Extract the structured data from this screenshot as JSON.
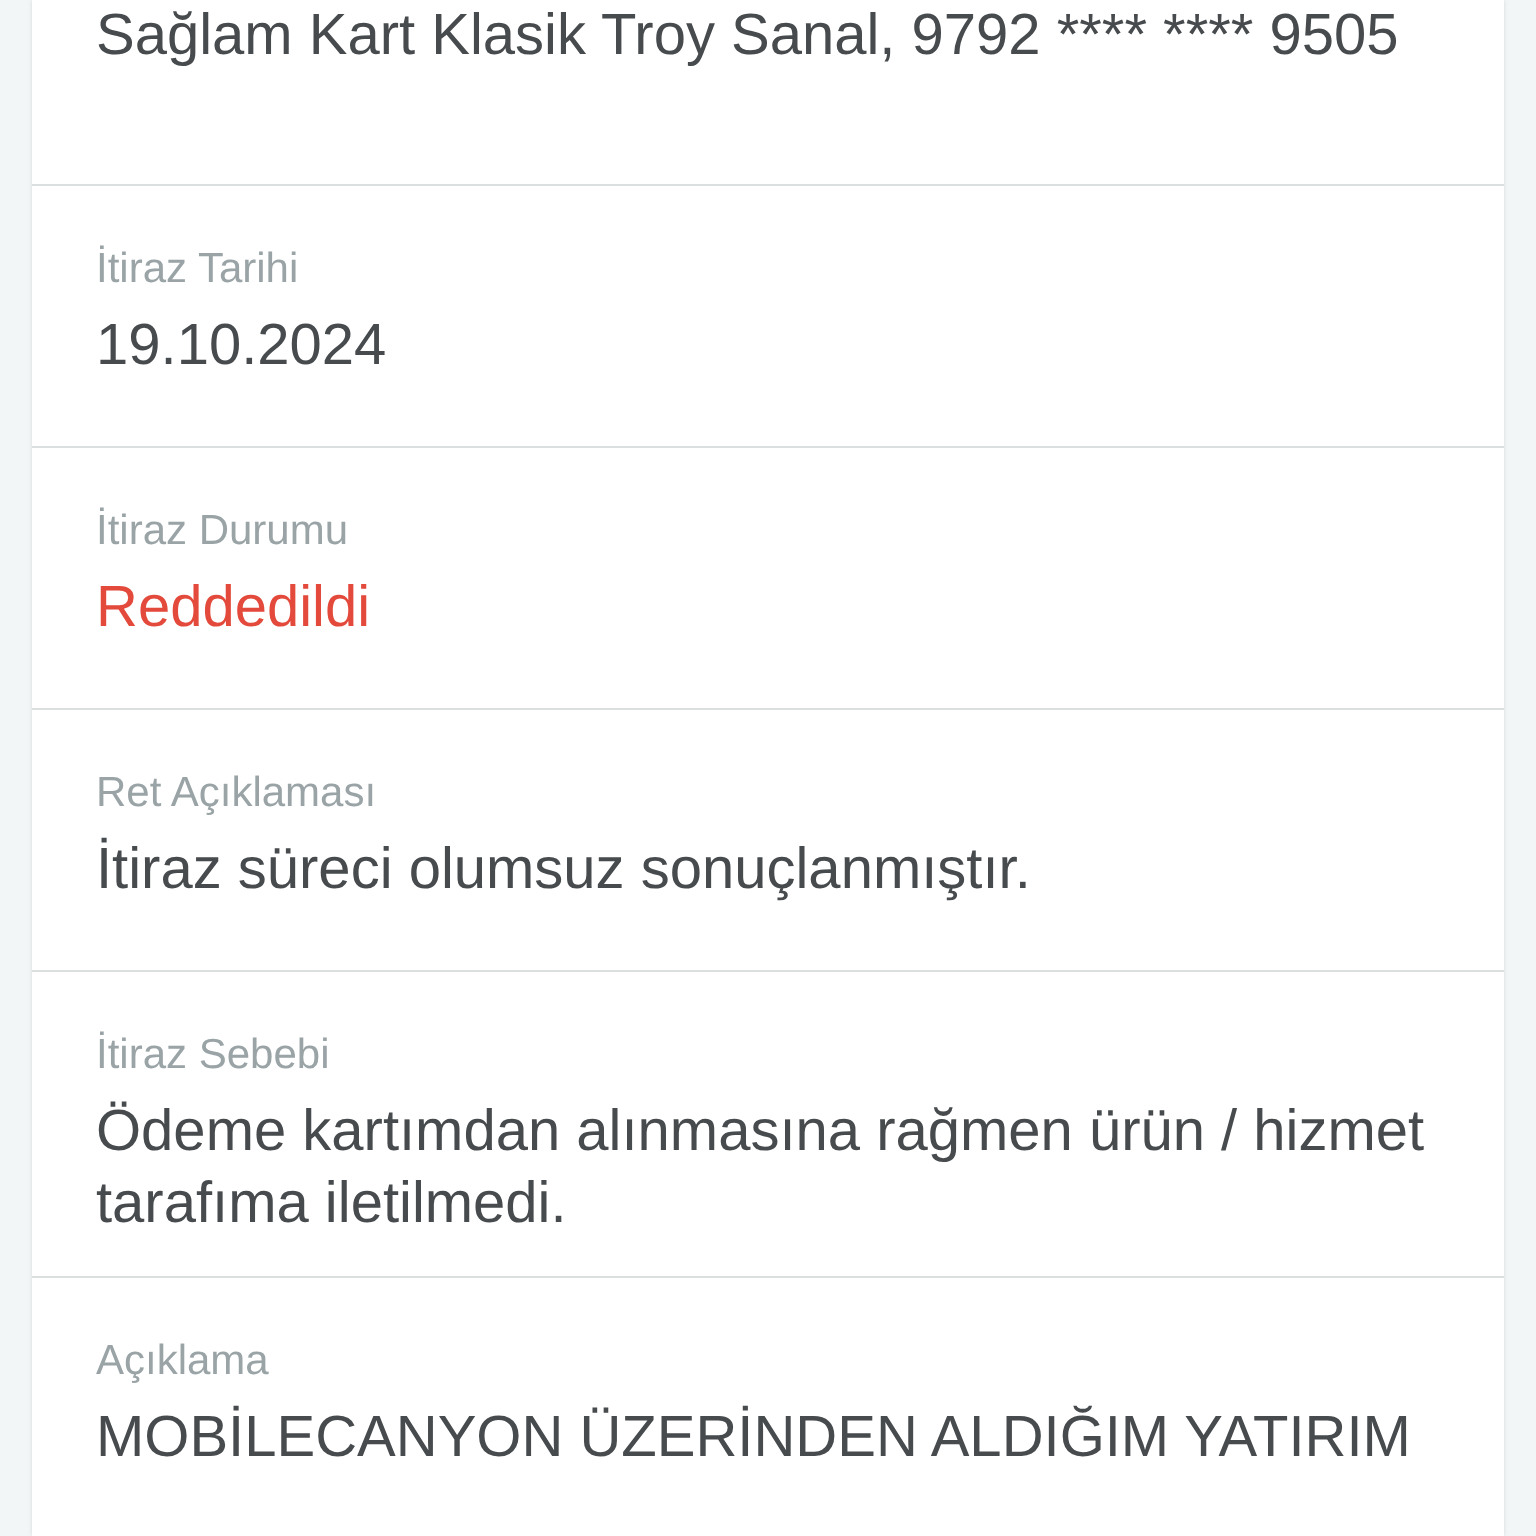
{
  "sections": [
    {
      "value": "Sağlam Kart Klasik Troy Sanal, 9792 **** **** 9505",
      "color": "#474b4d"
    },
    {
      "label": "İtiraz Tarihi",
      "value": "19.10.2024",
      "color": "#474b4d"
    },
    {
      "label": "İtiraz Durumu",
      "value": "Reddedildi",
      "color": "#e34a3b"
    },
    {
      "label": "Ret Açıklaması",
      "value": "İtiraz süreci olumsuz sonuçlanmıştır.",
      "color": "#474b4d"
    },
    {
      "label": "İtiraz Sebebi",
      "value": "Ödeme kartımdan alınmasına rağmen ürün / hizmet tarafıma iletilmedi.",
      "color": "#474b4d"
    },
    {
      "label": "Açıklama",
      "value": "MOBİLECANYON ÜZERİNDEN ALDIĞIM YATIRIM",
      "color": "#474b4d"
    }
  ]
}
